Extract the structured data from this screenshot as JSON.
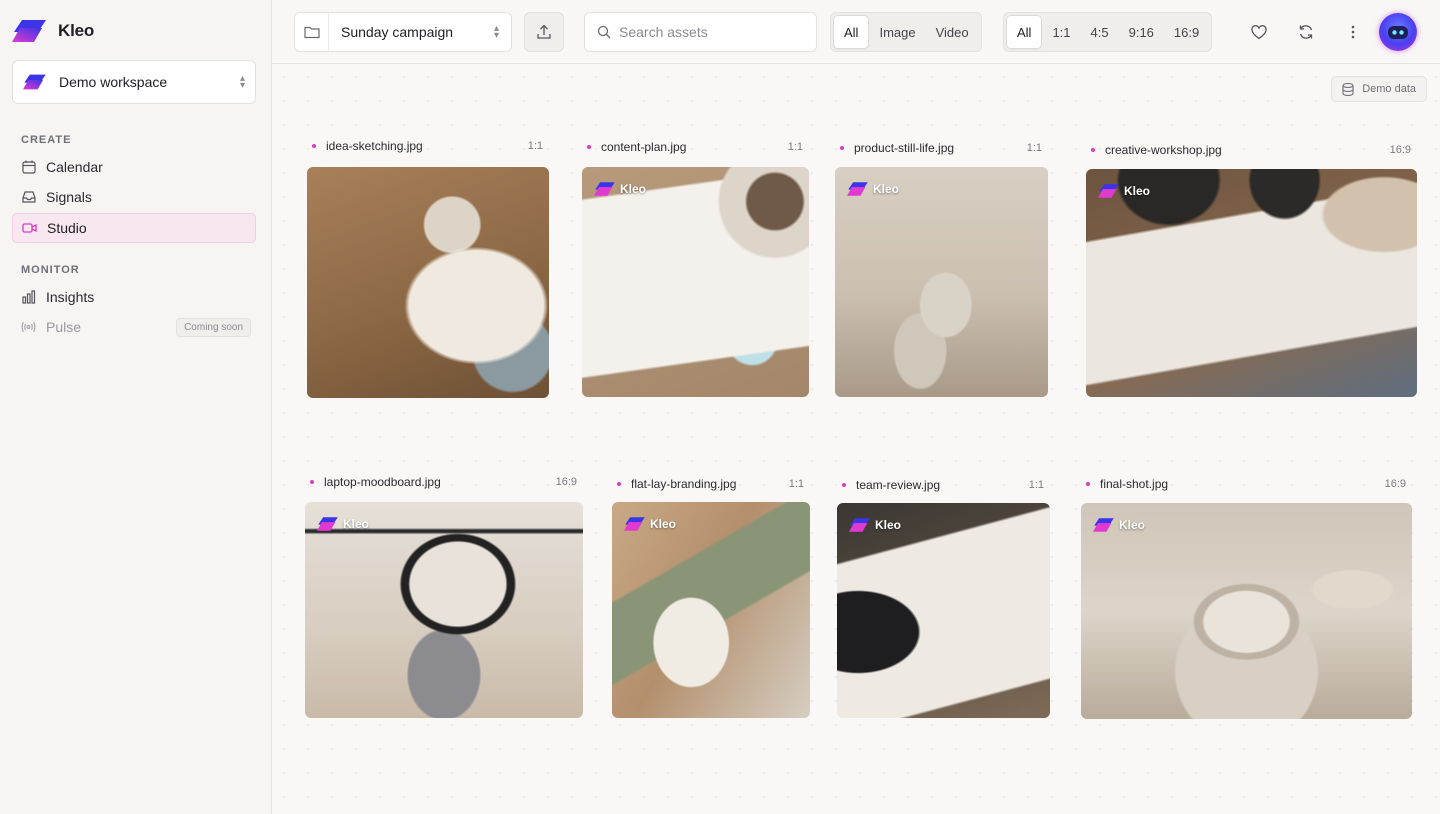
{
  "brand": {
    "name": "Kleo",
    "accent": "#d63dbf"
  },
  "workspace": {
    "label": "Demo workspace"
  },
  "sidebar": {
    "create_title": "CREATE",
    "create_items": [
      {
        "label": "Calendar",
        "icon": "calendar-icon"
      },
      {
        "label": "Signals",
        "icon": "inbox-icon"
      },
      {
        "label": "Studio",
        "icon": "video-icon",
        "active": true
      }
    ],
    "monitor_title": "MONITOR",
    "monitor_items": [
      {
        "label": "Insights",
        "icon": "bar-chart-icon"
      },
      {
        "label": "Pulse",
        "icon": "broadcast-icon",
        "badge": "Coming soon"
      }
    ]
  },
  "topbar": {
    "campaign": "Sunday campaign",
    "search_placeholder": "Search assets",
    "type_filters": [
      "All",
      "Image",
      "Video"
    ],
    "type_selected": "All",
    "ratio_filters": [
      "All",
      "1:1",
      "4:5",
      "9:16",
      "16:9"
    ],
    "ratio_selected": "All"
  },
  "main": {
    "demo_badge": "Demo data",
    "watermark": "Kleo",
    "assets": [
      {
        "name": "idea-sketching.jpg",
        "ratio": "1:1",
        "watermark": false
      },
      {
        "name": "content-plan.jpg",
        "ratio": "1:1",
        "watermark": true
      },
      {
        "name": "product-still-life.jpg",
        "ratio": "1:1",
        "watermark": true
      },
      {
        "name": "creative-workshop.jpg",
        "ratio": "16:9",
        "watermark": true
      },
      {
        "name": "laptop-moodboard.jpg",
        "ratio": "16:9",
        "watermark": true
      },
      {
        "name": "flat-lay-branding.jpg",
        "ratio": "1:1",
        "watermark": true
      },
      {
        "name": "team-review.jpg",
        "ratio": "1:1",
        "watermark": true
      },
      {
        "name": "final-shot.jpg",
        "ratio": "16:9",
        "watermark": true
      }
    ]
  }
}
